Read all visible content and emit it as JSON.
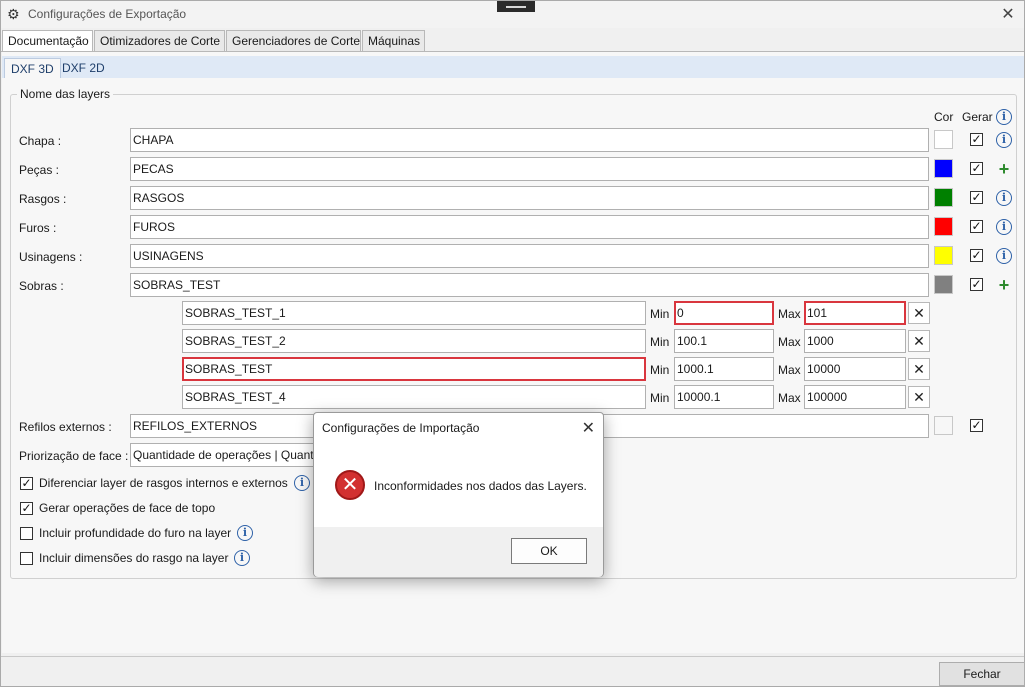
{
  "window": {
    "title": "Configurações de Exportação",
    "close_icon": "close-icon"
  },
  "main_tabs": [
    {
      "label": "Documentação",
      "active": true
    },
    {
      "label": "Otimizadores de Corte",
      "active": false
    },
    {
      "label": "Gerenciadores de Corte",
      "active": false
    },
    {
      "label": "Máquinas",
      "active": false
    }
  ],
  "sub_tabs": [
    {
      "label": "DXF 3D",
      "active": true
    },
    {
      "label": "DXF 2D",
      "active": false
    }
  ],
  "group": {
    "title": "Nome das layers",
    "col_cor": "Cor",
    "col_gerar": "Gerar"
  },
  "layers": [
    {
      "label": "Chapa :",
      "value": "CHAPA",
      "color": "#ffffff",
      "checked": true,
      "action": "info"
    },
    {
      "label": "Peças :",
      "value": "PECAS",
      "color": "#0000ff",
      "checked": true,
      "action": "plus"
    },
    {
      "label": "Rasgos :",
      "value": "RASGOS",
      "color": "#008000",
      "checked": true,
      "action": "info"
    },
    {
      "label": "Furos :",
      "value": "FUROS",
      "color": "#ff0000",
      "checked": true,
      "action": "info"
    },
    {
      "label": "Usinagens :",
      "value": "USINAGENS",
      "color": "#ffff00",
      "checked": true,
      "action": "info"
    },
    {
      "label": "Sobras :",
      "value": "SOBRAS_TEST",
      "color": "#808080",
      "checked": true,
      "action": "plus"
    }
  ],
  "sobras_sub": [
    {
      "name": "SOBRAS_TEST_1",
      "min": "0",
      "max": "101",
      "name_err": false,
      "min_err": true,
      "max_err": true
    },
    {
      "name": "SOBRAS_TEST_2",
      "min": "100.1",
      "max": "1000",
      "name_err": false,
      "min_err": false,
      "max_err": false
    },
    {
      "name": "SOBRAS_TEST",
      "min": "1000.1",
      "max": "10000",
      "name_err": true,
      "min_err": false,
      "max_err": false
    },
    {
      "name": "SOBRAS_TEST_4",
      "min": "10000.1",
      "max": "100000",
      "name_err": false,
      "min_err": false,
      "max_err": false
    }
  ],
  "labels": {
    "min": "Min",
    "max": "Max",
    "x": "✕"
  },
  "refilos": {
    "label": "Refilos externos :",
    "value": "REFILOS_EXTERNOS",
    "color": "#ffa500",
    "checked": true
  },
  "priorizacao": {
    "label": "Priorização de face :",
    "value": "Quantidade de operações | Quantidade"
  },
  "options": [
    {
      "label": "Diferenciar layer de rasgos internos e externos",
      "checked": true,
      "info": true
    },
    {
      "label": "Gerar operações de face de topo",
      "checked": true,
      "info": false
    },
    {
      "label": "Incluir profundidade do furo na layer",
      "checked": false,
      "info": true
    },
    {
      "label": "Incluir dimensões do rasgo na layer",
      "checked": false,
      "info": true
    }
  ],
  "footer": {
    "close_button": "Fechar"
  },
  "dialog": {
    "title": "Configurações de Importação",
    "message": "Inconformidades nos dados das Layers.",
    "ok": "OK",
    "icon": "error-icon"
  }
}
